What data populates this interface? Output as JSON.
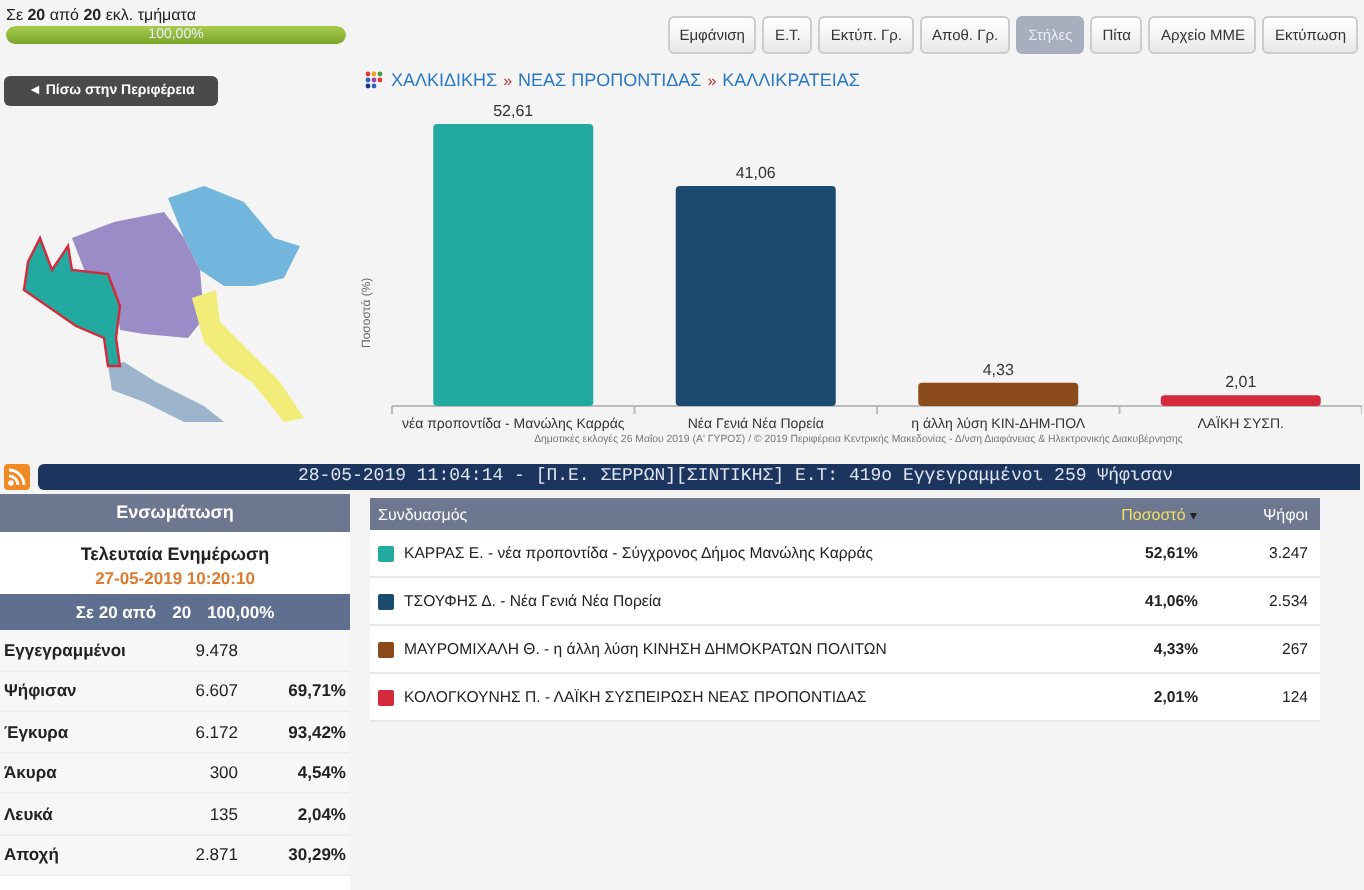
{
  "progress": {
    "text": "Σε **20** από **20** εκλ. τμήματα",
    "level": 1.0,
    "reading": "100,00%"
  },
  "toolbar": [
    {
      "label": "Εμφάνιση",
      "selected": false
    },
    {
      "label": "Ε.Τ.",
      "selected": false
    },
    {
      "label": "Εκτύπ. Γρ.",
      "selected": false
    },
    {
      "label": "Αποθ. Γρ.",
      "selected": false
    },
    {
      "label": "Στήλες",
      "selected": true
    },
    {
      "label": "Πίτα",
      "selected": false
    },
    {
      "label": "Αρχείο ΜΜΕ",
      "selected": false
    },
    {
      "label": "Εκτύπωση",
      "selected": false
    }
  ],
  "back_button": "◄ Πίσω στην Περιφέρεια",
  "breadcrumb": {
    "items": [
      "ΧΑΛΚΙΔΙΚΗΣ",
      "ΝΕΑΣ ΠΡΟΠΟΝΤΙΔΑΣ",
      "ΚΑΛΛΙΚΡΑΤΕΙΑΣ"
    ],
    "separator": "»"
  },
  "chart_data": {
    "type": "bar",
    "ylabel": "Ποσοστά (%)",
    "categories": [
      "νέα προποντίδα - Μανώλης Καρράς",
      "Νέα Γενιά Νέα Πορεία",
      "η άλλη λύση ΚΙΝ-ΔΗΜ-ΠΟΛ",
      "ΛΑΪΚΗ ΣΥΣΠ."
    ],
    "values": [
      52.61,
      41.06,
      4.33,
      2.01
    ],
    "value_labels": [
      "52,61",
      "41,06",
      "4,33",
      "2,01"
    ]
  },
  "credit": "Δημοτικές εκλογές 26 Μαΐου 2019 (Α' ΓΥΡΟΣ) / © 2019 Περιφέρεια Κεντρικής Μακεδονίας - Δ/νση Διαφάνειας & Ηλεκτρονικής Διακυβέρνησης",
  "ticker": "28-05-2019 11:04:14 - [Π.Ε. ΣΕΡΡΩΝ][ΣΙΝΤΙΚΗΣ]  Ε.Τ: 419ο  Εγγεγραμμένοι 259  Ψήφισαν",
  "summary": {
    "title": "Ενσωμάτωση",
    "update_label": "Τελευταία Ενημέρωση",
    "update_time": "27-05-2019 10:20:10",
    "counted": [
      "Σε 20 από",
      "20",
      "100,00%"
    ],
    "rows": [
      {
        "label": "Εγγεγραμμένοι",
        "value": "9.478"
      },
      {
        "label": "Ψήφισαν",
        "value": "6.607",
        "percent": "69,71%"
      },
      {
        "label": "Έγκυρα",
        "value": "6.172",
        "percent": "93,42%"
      },
      {
        "label": "Άκυρα",
        "value": "300",
        "percent": "4,54%"
      },
      {
        "label": "Λευκά",
        "value": "135",
        "percent": "2,04%"
      },
      {
        "label": "Αποχή",
        "value": "2.871",
        "percent": "30,29%"
      }
    ]
  },
  "table": {
    "columns": [
      "Συνδυασμός",
      "Ποσοστό",
      "Ψήφοι"
    ],
    "sort_caret": "▾",
    "rows": [
      {
        "name": "ΚΑΡΡΑΣ Ε. - νέα προποντίδα - Σύγχρονος Δήμος Μανώλης Καρράς",
        "percent": "52,61%",
        "votes": "3.247",
        "color": "#22aaa0"
      },
      {
        "name": "ΤΣΟΥΦΗΣ Δ. - Νέα Γενιά Νέα Πορεία",
        "percent": "41,06%",
        "votes": "2.534",
        "color": "#1a4a6e"
      },
      {
        "name": "ΜΑΥΡΟΜΙΧΑΛΗ Θ. - η άλλη λύση ΚΙΝΗΣΗ ΔΗΜΟΚΡΑΤΩΝ ΠΟΛΙΤΩΝ",
        "percent": "4,33%",
        "votes": "267",
        "color": "#8b4a1a"
      },
      {
        "name": "ΚΟΛΟΓΚΟΥΝΗΣ Π. - ΛΑΪΚΗ ΣΥΣΠΕΙΡΩΣΗ ΝΕΑΣ ΠΡΟΠΟΝΤΙΔΑΣ",
        "percent": "2,01%",
        "votes": "124",
        "color": "#d42a3c"
      }
    ]
  }
}
